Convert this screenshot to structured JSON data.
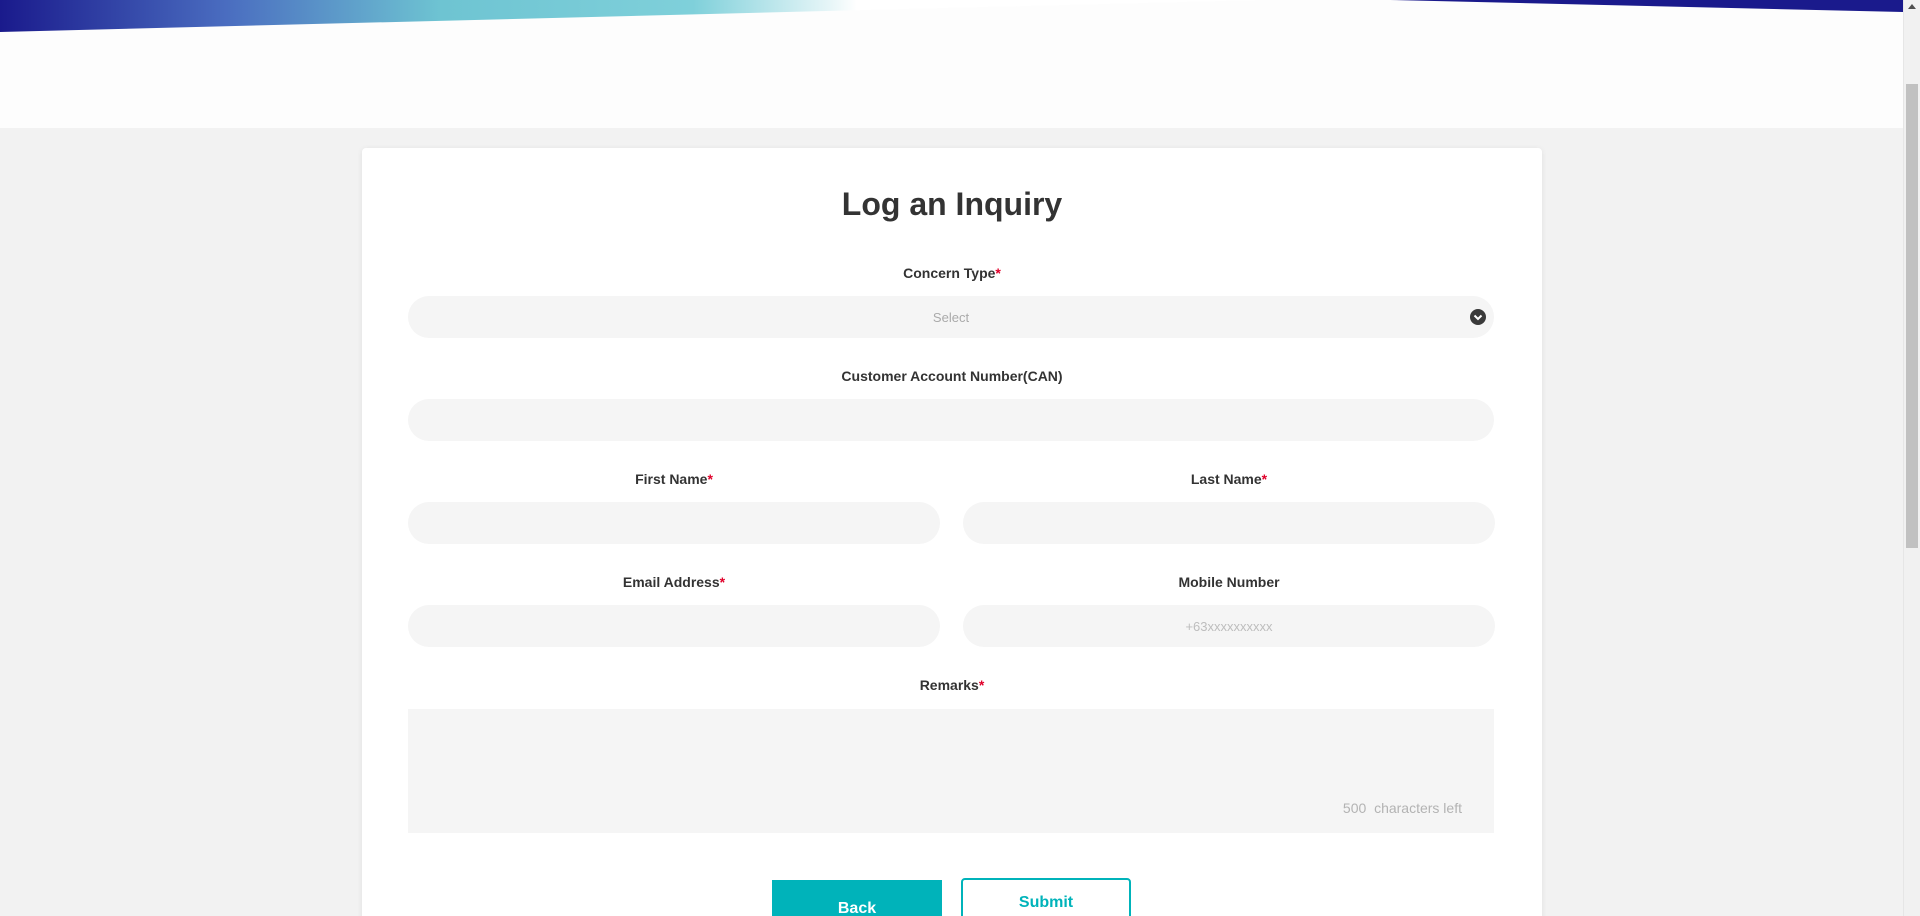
{
  "form": {
    "title": "Log an Inquiry",
    "required_mark": "*",
    "concern_type": {
      "label": "Concern Type",
      "placeholder": "Select"
    },
    "can": {
      "label": "Customer Account Number(CAN)",
      "value": ""
    },
    "first_name": {
      "label": "First Name",
      "value": ""
    },
    "last_name": {
      "label": "Last Name",
      "value": ""
    },
    "email": {
      "label": "Email Address",
      "value": ""
    },
    "mobile": {
      "label": "Mobile Number",
      "placeholder": "+63xxxxxxxxxx"
    },
    "remarks": {
      "label": "Remarks",
      "value": "",
      "chars_left": "500",
      "chars_left_suffix": "characters left"
    },
    "buttons": {
      "back": "Back",
      "submit": "Submit"
    }
  },
  "colors": {
    "accent": "#00b3ba",
    "required": "#e0002a",
    "banner_dark": "#1f1f8f",
    "banner_light": "#6fc9d3"
  }
}
